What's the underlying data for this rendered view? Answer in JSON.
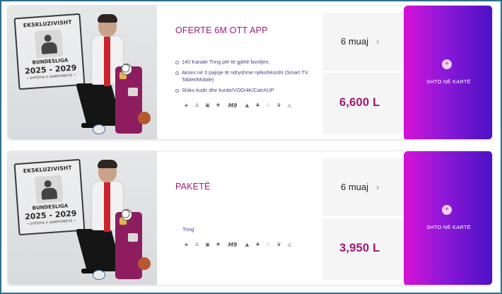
{
  "colors": {
    "accent_title": "#a0197b",
    "price": "#a0196f",
    "cta_gradient_start": "#d612d6",
    "cta_gradient_end": "#4a10c4"
  },
  "offers": [
    {
      "image": {
        "stamp_top": "EKSKLUZIVISHT",
        "stamp_name": "BUNDESLIGA",
        "stamp_years": "2025 - 2029",
        "stamp_sub": "• SHTËPIA E KAMPIONËVE •"
      },
      "title": "OFERTE 6M OTT APP",
      "features": [
        "140 Kanale Tring për të gjithë familjen.",
        "Akses në 3 pajisje të ndryshme njëkohësisht (Smart TV, Tablet/Mobile)",
        "Shiko kudo dhe kurdo/VOD/4K/CatchUP"
      ],
      "period": "6 muaj",
      "price": "6,600 L",
      "cta_label": "SHTO NË KARTË",
      "cta_icon": "+",
      "channel_icons": [
        "◈",
        "♙",
        "▣",
        "✚",
        "M9",
        "▲",
        "♣",
        "♘",
        "♛",
        "◬"
      ]
    },
    {
      "image": {
        "stamp_top": "EKSKLUZIVISHT",
        "stamp_name": "BUNDESLIGA",
        "stamp_years": "2025 - 2029",
        "stamp_sub": "• SHTËPIA E KAMPIONËVE •"
      },
      "title": "PAKETË",
      "plain_text": "Tring",
      "period": "6 muaj",
      "price": "3,950 L",
      "cta_label": "SHTO NË KARTË",
      "cta_icon": "+",
      "channel_icons": [
        "◈",
        "♙",
        "▣",
        "✚",
        "M9",
        "▲",
        "♣",
        "♘",
        "♛",
        "◬"
      ]
    }
  ]
}
